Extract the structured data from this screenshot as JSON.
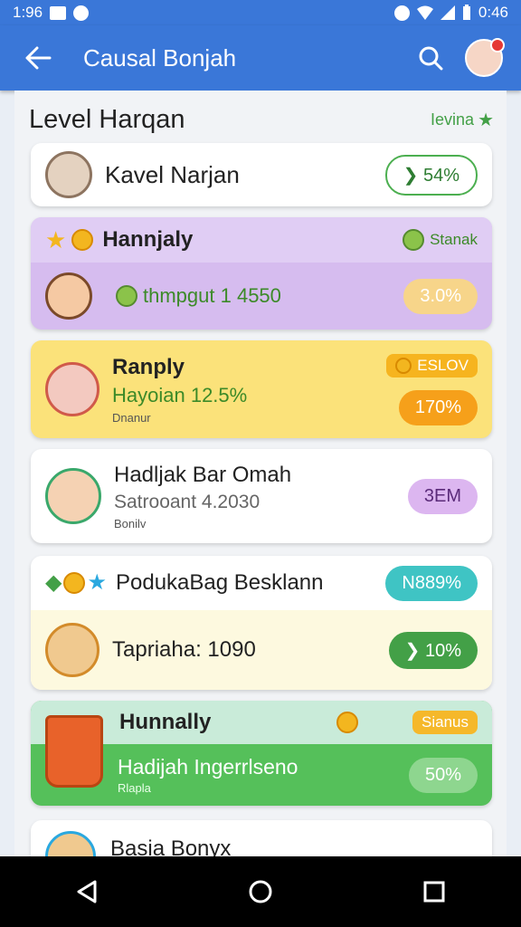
{
  "status": {
    "time_left": "1:96",
    "time_right": "0:46"
  },
  "app_bar": {
    "title": "Causal Bonjah"
  },
  "header": {
    "title": "Level Harqan",
    "link": "Ievina"
  },
  "cards": [
    {
      "name": "Kavel Narjan",
      "badge": "54%"
    },
    {
      "name": "Hannjaly",
      "tag": "Stanak",
      "value": "thmpgut 1 4550",
      "badge": "3.0%"
    },
    {
      "name": "Ranply",
      "tag": "ESLOV",
      "value": "Hayoian 12.5%",
      "small": "Dnanur",
      "badge": "170%"
    },
    {
      "name": "Hadljak Bar Omah",
      "value": "Satrooant 4.2030",
      "small": "Bonilv",
      "badge": "3EM"
    },
    {
      "name": "PodukaBag Besklann",
      "badge": "N889%",
      "sub_name": "Tapriaha: 1090",
      "sub_badge": "10%"
    },
    {
      "name": "Hunnally",
      "tag": "Sianus",
      "value": "Hadijah Ingerrlseno",
      "small": "Rlapla",
      "badge": "50%"
    },
    {
      "name": "Basia Bonyx"
    }
  ],
  "colors": {
    "primary": "#3a77d8",
    "purple": "#d6bcef",
    "yellow": "#fbe27a",
    "green": "#55c05a",
    "mint": "#c9ebd9"
  }
}
